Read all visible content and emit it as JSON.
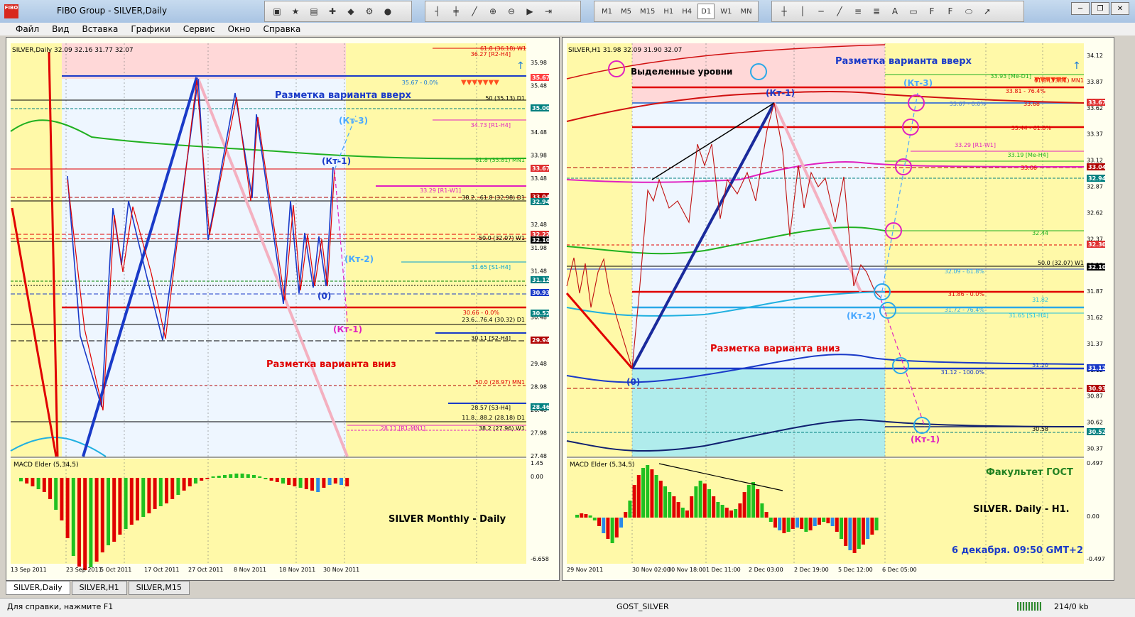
{
  "app": {
    "title": "FIBO Group - SILVER,Daily",
    "icon_text": "FIBO"
  },
  "menu": [
    "Файл",
    "Вид",
    "Вставка",
    "Графики",
    "Сервис",
    "Окно",
    "Справка"
  ],
  "timeframes": [
    "M1",
    "M5",
    "M15",
    "H1",
    "H4",
    "D1",
    "W1",
    "MN"
  ],
  "active_timeframe": "D1",
  "left_chart": {
    "header": "SILVER,Daily  32.09 32.16 31.77 32.07",
    "up_label": "Разметка варианта вверх",
    "down_label": "Разметка варианта вниз",
    "kt1": "(Кт-1)",
    "kt2": "(Кт-2)",
    "kt3": "(Кт-3)",
    "kt_minus1": "(Кт-1)",
    "zero": "(0)",
    "price_axis": [
      "35.98",
      "35.48",
      "34.98",
      "34.48",
      "33.98",
      "33.48",
      "32.98",
      "32.48",
      "31.98",
      "31.48",
      "30.98",
      "30.48",
      "29.98",
      "29.48",
      "28.98",
      "28.48",
      "27.98",
      "27.48"
    ],
    "price_badges": [
      {
        "label": "35.67",
        "color": "#ff4040"
      },
      {
        "label": "35.00",
        "color": "#008080"
      },
      {
        "label": "33.67",
        "color": "#e03030"
      },
      {
        "label": "33.04",
        "color": "#b00000"
      },
      {
        "label": "32.94",
        "color": "#008080"
      },
      {
        "label": "32.22",
        "color": "#e03030"
      },
      {
        "label": "32.10",
        "color": "#000000"
      },
      {
        "label": "31.12",
        "color": "#008080"
      },
      {
        "label": "30.93",
        "color": "#1a3ac8"
      },
      {
        "label": "30.52",
        "color": "#008080"
      },
      {
        "label": "29.94",
        "color": "#b00000"
      },
      {
        "label": "28.46",
        "color": "#008080"
      }
    ],
    "level_labels": [
      "61.8 (36.18) W1",
      "36.27 [R2-H4]",
      "35.67 - 0.0%",
      "50 (35.13) D1",
      "34.73 [R1-H4]",
      "61.8 (33.81) MN1",
      "33.29 [R1-W1]",
      "38.2...61.8 (32.98) D1",
      "50.0 (32.07) W1",
      "31.65 [S1-H4]",
      "30.66 - 0.0%",
      "23.6...76.4 (30.32) D1",
      "30.11 [S2-H4]",
      "50.0 (28.97) MN1",
      "28.57 [S3-H4]",
      "11.8...88.2 (28.18) D1",
      "28.11 [R1-MN1]",
      "38.2 (27.96) W1"
    ],
    "macd_title": "MACD Elder (5,34,5)",
    "macd_axis": [
      "1.45",
      "0.00",
      "-6.658"
    ],
    "caption": "SILVER  Monthly - Daily",
    "dates": [
      "13 Sep 2011",
      "23 Sep 2011",
      "5 Oct 2011",
      "17 Oct 2011",
      "27 Oct 2011",
      "8 Nov 2011",
      "18 Nov 2011",
      "30 Nov 2011"
    ]
  },
  "right_chart": {
    "header": "SILVER,H1  31.98 32.09 31.90 32.07",
    "legend_label": "Выделенные уровни",
    "up_label": "Разметка варианта вверх",
    "down_label": "Разметка варианта вниз",
    "kt1": "(Кт-1)",
    "kt2": "(Кт-2)",
    "kt3": "(Кт-3)",
    "kt_minus1": "(Кт-1)",
    "zero": "(0)",
    "price_axis": [
      "34.12",
      "33.87",
      "33.62",
      "33.37",
      "33.12",
      "32.87",
      "32.62",
      "32.37",
      "32.12",
      "31.87",
      "31.62",
      "31.37",
      "31.12",
      "30.87",
      "30.62",
      "30.37"
    ],
    "price_badges": [
      {
        "label": "33.67",
        "color": "#e03030"
      },
      {
        "label": "33.04",
        "color": "#b00000"
      },
      {
        "label": "32.94",
        "color": "#008080"
      },
      {
        "label": "32.30",
        "color": "#e03030"
      },
      {
        "label": "32.10",
        "color": "#000000"
      },
      {
        "label": "31.12",
        "color": "#1a3ac8"
      },
      {
        "label": "30.93",
        "color": "#b00000"
      },
      {
        "label": "30.52",
        "color": "#008080"
      }
    ],
    "level_labels": [
      "33.93 [Me-D1]",
      "61.8 (33.81) MN1",
      "33.81 - 76.4%",
      "33.67 - 0.0%",
      "33.68",
      "33.44 - 61.8%",
      "33.29 [R1-W1]",
      "33.19 [Me-H4]",
      "33.06",
      "32.44",
      "50.0 (32.07) W1",
      "32.09 - 61.8%",
      "31.86 - 0.0%",
      "31.82",
      "31.72 - 76.4%",
      "31.65 [S1-H4]",
      "31.20",
      "31.12 - 100.0%",
      "30.58"
    ],
    "macd_title": "MACD Elder (5,34,5)",
    "macd_axis": [
      "0.497",
      "0.00",
      "-0.497"
    ],
    "caption1": "Факультет ГОСТ",
    "caption2": "SILVER. Daily - H1.",
    "caption3": "6 декабря. 09:50 GMT+2",
    "dates": [
      "29 Nov 2011",
      "30 Nov 02:00",
      "30 Nov 18:00",
      "1 Dec 11:00",
      "2 Dec 03:00",
      "2 Dec 19:00",
      "5 Dec 12:00",
      "6 Dec 05:00"
    ]
  },
  "tabs": [
    "SILVER,Daily",
    "SILVER,H1",
    "SILVER,M15"
  ],
  "active_tab": "SILVER,Daily",
  "status": {
    "help": "Для справки, нажмите F1",
    "profile": "GOST_SILVER",
    "kb": "214/0 kb"
  }
}
